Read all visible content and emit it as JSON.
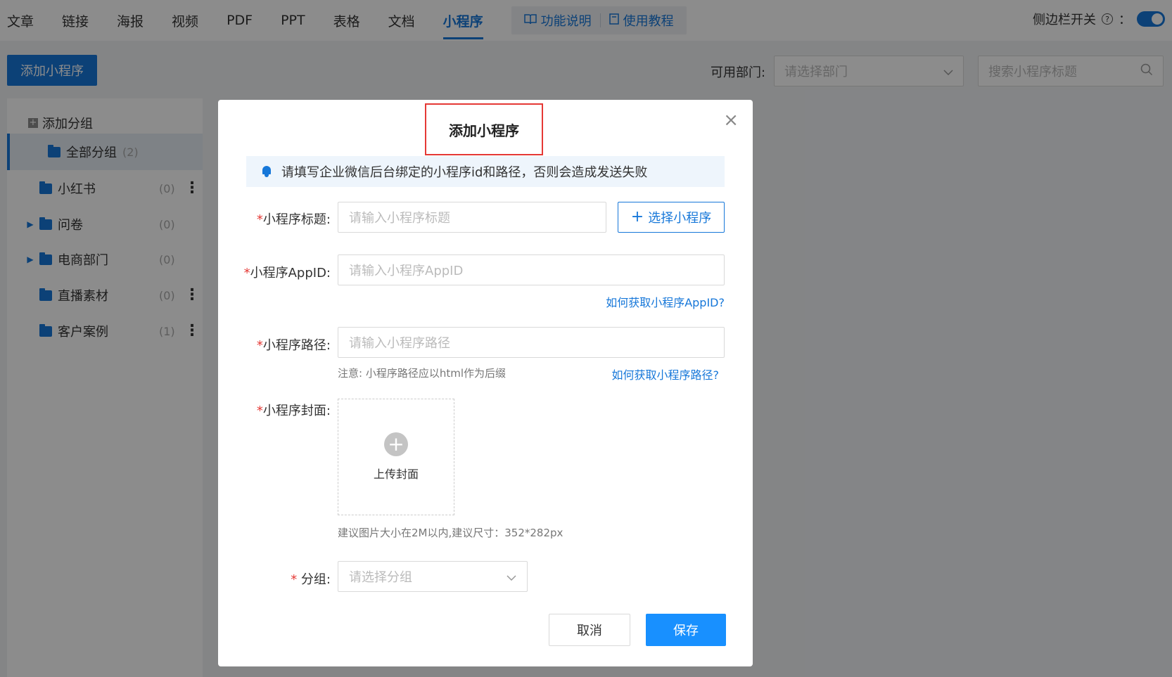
{
  "topnav": {
    "tabs": [
      "文章",
      "链接",
      "海报",
      "视频",
      "PDF",
      "PPT",
      "表格",
      "文档",
      "小程序"
    ],
    "active_tab": "小程序",
    "help_links": [
      "功能说明",
      "使用教程"
    ],
    "sidebar_toggle_label": "侧边栏开关",
    "sidebar_toggle_colon": "："
  },
  "toolbar": {
    "add_button": "添加小程序",
    "dept_label": "可用部门:",
    "dept_placeholder": "请选择部门",
    "search_placeholder": "搜索小程序标题"
  },
  "sidebar": {
    "add_group": "添加分组",
    "groups": [
      {
        "name": "全部分组",
        "count": "(2)"
      },
      {
        "name": "小红书",
        "count": "(0)"
      },
      {
        "name": "问卷",
        "count": "(0)"
      },
      {
        "name": "电商部门",
        "count": "(0)"
      },
      {
        "name": "直播素材",
        "count": "(0)"
      },
      {
        "name": "客户案例",
        "count": "(1)"
      }
    ]
  },
  "modal": {
    "title": "添加小程序",
    "notice": "请填写企业微信后台绑定的小程序id和路径，否则会造成发送失败",
    "title_label": "小程序标题:",
    "title_placeholder": "请输入小程序标题",
    "select_button": "选择小程序",
    "appid_label": "小程序AppID:",
    "appid_placeholder": "请输入小程序AppID",
    "appid_help": "如何获取小程序AppID?",
    "path_label": "小程序路径:",
    "path_placeholder": "请输入小程序路径",
    "path_note": "注意: 小程序路径应以html作为后缀",
    "path_help": "如何获取小程序路径?",
    "cover_label": "小程序封面:",
    "upload_text": "上传封面",
    "cover_hint": "建议图片大小在2M以内,建议尺寸：352*282px",
    "group_label": "分组:",
    "group_placeholder": "请选择分组",
    "cancel": "取消",
    "save": "保存"
  }
}
